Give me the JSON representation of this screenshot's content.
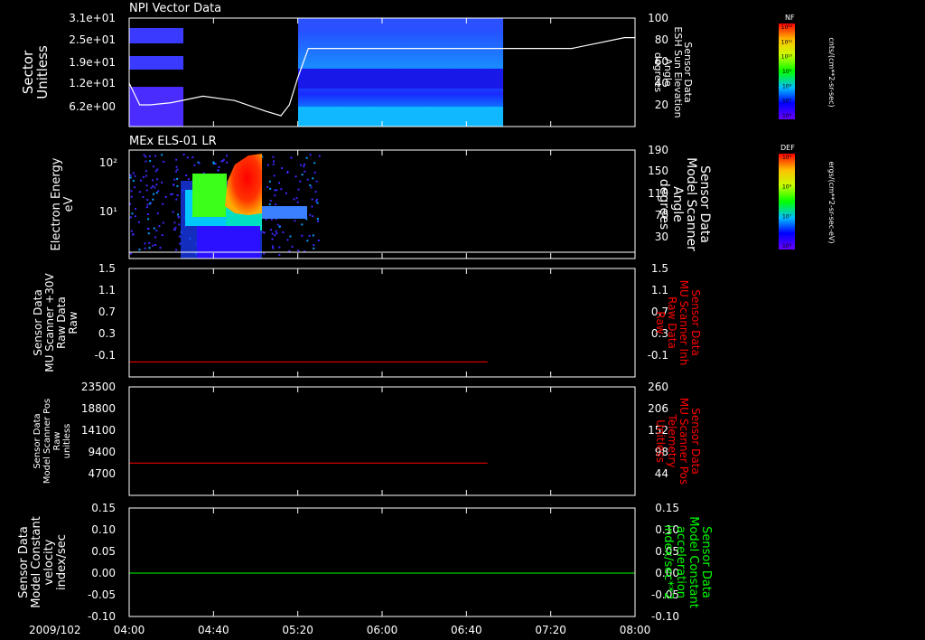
{
  "colors": {
    "background": "#000000",
    "axis": "#ffffff",
    "red_trace": "#ff0000",
    "green_trace": "#00ff00",
    "white_trace": "#ffffff"
  },
  "time_axis": {
    "date_label": "2009/102",
    "ticks": [
      "04:00",
      "04:40",
      "05:20",
      "06:00",
      "06:40",
      "07:20",
      "08:00"
    ],
    "range": [
      "04:00",
      "08:00"
    ]
  },
  "panels": [
    {
      "id": "npi",
      "title": "NPI Vector Data",
      "left_label": [
        "Sector",
        "Unitless"
      ],
      "left_ticks": [
        "3.1e+01",
        "2.5e+01",
        "1.9e+01",
        "1.2e+01",
        "6.2e+00"
      ],
      "right_label": [
        "Sensor Data",
        "ESH Sun Elevation",
        "Angle",
        "degrees"
      ],
      "right_ticks": [
        "100",
        "80",
        "60",
        "40",
        "20"
      ],
      "colorbar": {
        "name": "NF",
        "labels": [
          "10¹²",
          "10¹¹",
          "10¹⁰",
          "10⁹",
          "10⁸",
          "10⁷",
          "10⁶"
        ],
        "units": "cnts/(cm**2-sr-sec)"
      }
    },
    {
      "id": "els",
      "title": "MEx ELS-01 LR",
      "left_label": [
        "Electron Energy",
        "eV"
      ],
      "left_ticks": [
        "10²",
        "10¹"
      ],
      "right_label": [
        "Sensor Data",
        "Model Scanner",
        "Angle",
        "degrees"
      ],
      "right_ticks": [
        "190",
        "150",
        "110",
        "70",
        "30"
      ],
      "colorbar": {
        "name": "DEF",
        "labels": [
          "10⁹",
          "10⁸",
          "10⁷",
          "10⁶"
        ],
        "units": "ergs/(cm**2-sr-sec-eV)"
      }
    },
    {
      "id": "mu_raw",
      "left_label": [
        "Sensor Data",
        "MU Scanner +30V",
        "Raw Data",
        "Raw"
      ],
      "left_ticks": [
        "1.5",
        "1.1",
        "0.7",
        "0.3",
        "-0.1"
      ],
      "right_label": [
        "Sensor Data",
        "MU Scanner Inh",
        "Raw Data",
        "Raw"
      ],
      "right_ticks": [
        "1.5",
        "1.1",
        "0.7",
        "0.3",
        "-0.1"
      ]
    },
    {
      "id": "scanner_pos",
      "left_label": [
        "Sensor Data",
        "Model Scanner Pos",
        "Raw",
        "unitless"
      ],
      "left_ticks": [
        "23500",
        "18800",
        "14100",
        "9400",
        "4700"
      ],
      "right_label": [
        "Sensor Data",
        "MU Scanner Pos",
        "Telemetry",
        "Unitless"
      ],
      "right_ticks": [
        "260",
        "206",
        "152",
        "98",
        "44"
      ]
    },
    {
      "id": "constant",
      "left_label": [
        "Sensor Data",
        "Model Constant",
        "velocity",
        "index/sec"
      ],
      "left_ticks": [
        "0.15",
        "0.10",
        "0.05",
        "0.00",
        "-0.05",
        "-0.10"
      ],
      "right_label": [
        "Sensor Data",
        "Model Constant",
        "acceleration",
        "index/sec**2"
      ],
      "right_ticks": [
        "0.15",
        "0.10",
        "0.05",
        "0.00",
        "-0.05",
        "-0.10"
      ]
    }
  ],
  "chart_data": [
    {
      "type": "heatmap",
      "title": "NPI Vector Data",
      "ylabel": "Sector Unitless",
      "ylim": [
        0,
        35
      ],
      "x_range": [
        "04:00",
        "08:00"
      ],
      "blocks": [
        {
          "x": [
            "04:00",
            "04:22"
          ],
          "y": [
            27,
            31
          ],
          "level": "blue"
        },
        {
          "x": [
            "04:00",
            "04:22"
          ],
          "y": [
            19,
            22
          ],
          "level": "blue"
        },
        {
          "x": [
            "04:00",
            "04:22"
          ],
          "y": [
            8,
            13
          ],
          "level": "blue"
        },
        {
          "x": [
            "05:20",
            "06:54"
          ],
          "y": [
            0,
            35
          ],
          "level": "cyan-blue"
        }
      ],
      "overlay": {
        "ylabel": "Sensor Data ESH Sun Elevation Angle degrees",
        "ylim": [
          0,
          100
        ],
        "x": [
          "04:00",
          "04:05",
          "04:10",
          "04:20",
          "04:35",
          "04:50",
          "05:05",
          "05:12",
          "05:16",
          "05:20",
          "05:25",
          "05:35",
          "06:00",
          "06:40",
          "07:05",
          "07:30",
          "07:40",
          "07:55",
          "08:00"
        ],
        "values": [
          40,
          20,
          20,
          22,
          28,
          24,
          14,
          10,
          20,
          45,
          72,
          72,
          72,
          72,
          72,
          72,
          76,
          82,
          82
        ]
      }
    },
    {
      "type": "heatmap",
      "title": "MEx ELS-01 LR",
      "ylabel": "Electron Energy eV",
      "x_range": [
        "04:00",
        "05:30"
      ],
      "overlay": {
        "ylabel": "Sensor Data Model Scanner Angle degrees",
        "ylim": [
          0,
          190
        ],
        "x": [
          "04:00",
          "08:00"
        ],
        "values": [
          11,
          11
        ]
      }
    },
    {
      "type": "line",
      "ylabel": "Sensor Data MU Scanner +30V Raw Data Raw",
      "ylim": [
        -0.3,
        1.5
      ],
      "x": [
        "04:00",
        "06:50"
      ],
      "values": [
        -0.05,
        -0.05
      ]
    },
    {
      "type": "line",
      "ylabel": "Sensor Data Model Scanner Pos Raw unitless",
      "ylim": [
        0,
        23500
      ],
      "x": [
        "04:00",
        "06:50"
      ],
      "values": [
        7000,
        7000
      ]
    },
    {
      "type": "line",
      "ylabel": "Sensor Data Model Constant velocity index/sec",
      "ylim": [
        -0.1,
        0.15
      ],
      "x": [
        "04:00",
        "08:00"
      ],
      "values": [
        0.0,
        0.0
      ]
    }
  ]
}
